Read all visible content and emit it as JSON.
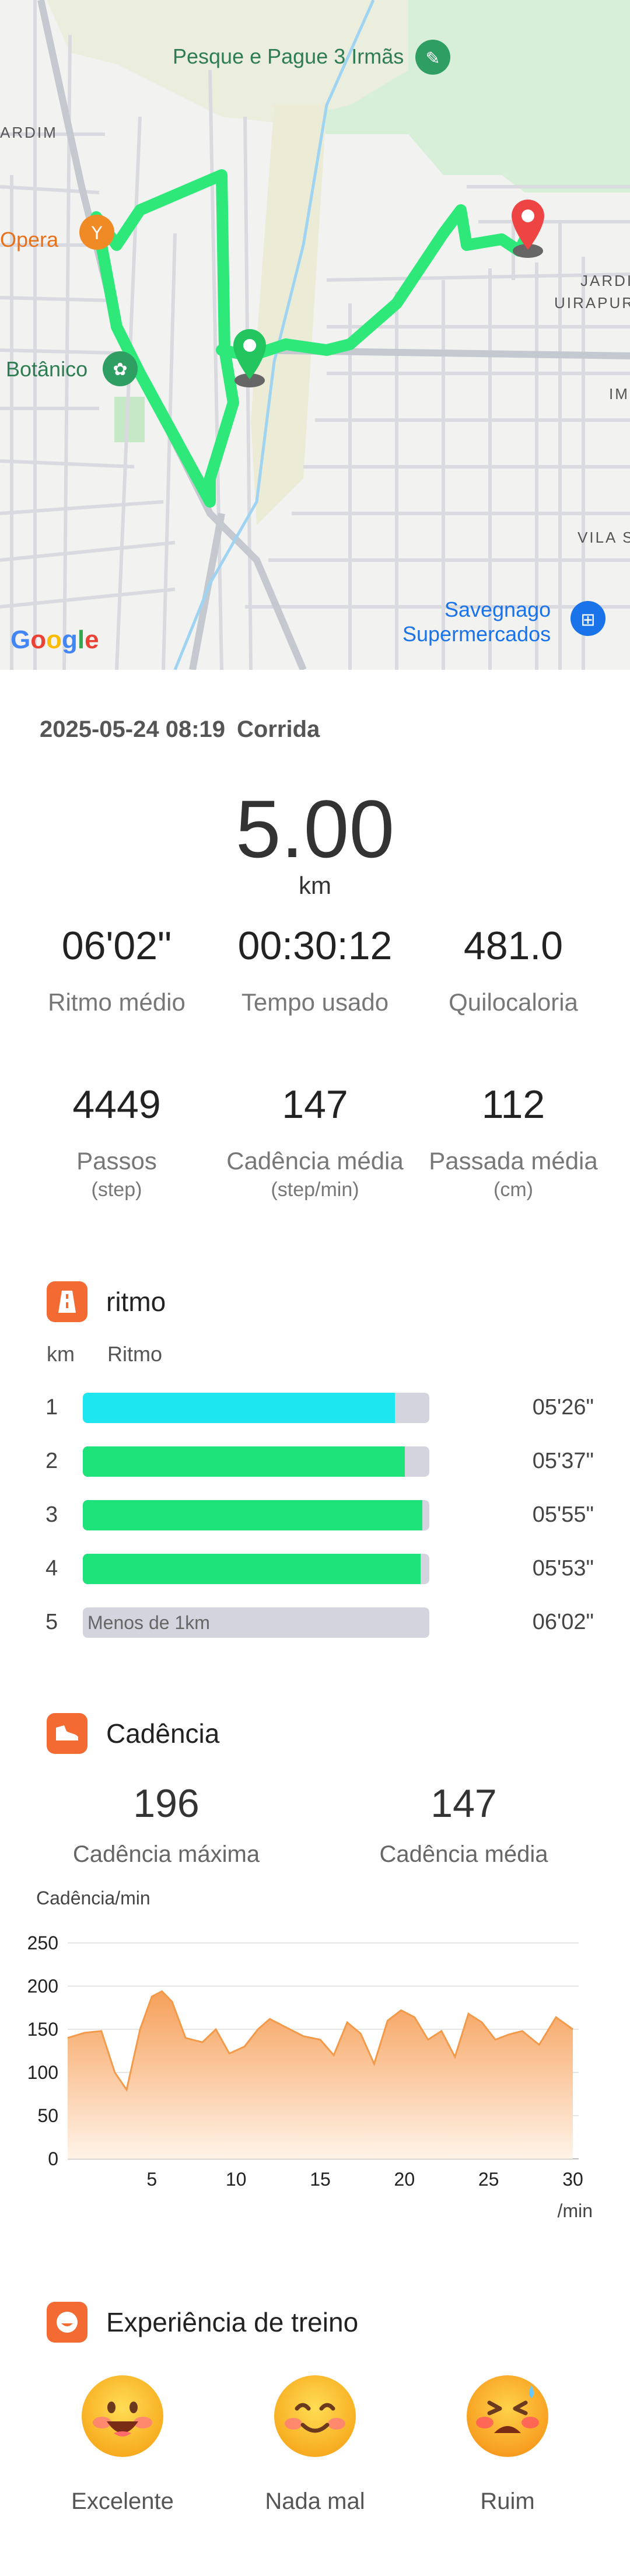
{
  "map": {
    "labels": {
      "pesque": "Pesque e Pague 3 Irmãs",
      "jardim_left": "ARDIM",
      "opera": "Opera",
      "jardim_uirapuru": "JARDIM\nUIRAPURU",
      "botanico": "Botânico",
      "vila": "VILA S",
      "im": "IM",
      "savegnago": "Savegnago\nSupermercados"
    },
    "google_logo": "Google",
    "colors": {
      "route": "#2ee87a",
      "start": "#22c55e",
      "end": "#ef4444"
    }
  },
  "workout": {
    "date": "2025-05-24 08:19",
    "type": "Corrida",
    "distance": "5.00",
    "distance_unit": "km"
  },
  "stats_row1": [
    {
      "value": "06'02\"",
      "label": "Ritmo médio"
    },
    {
      "value": "00:30:12",
      "label": "Tempo usado"
    },
    {
      "value": "481.0",
      "label": "Quilocaloria"
    }
  ],
  "stats_row2": [
    {
      "value": "4449",
      "label": "Passos",
      "unit": "(step)"
    },
    {
      "value": "147",
      "label": "Cadência média",
      "unit": "(step/min)"
    },
    {
      "value": "112",
      "label": "Passada média",
      "unit": "(cm)"
    }
  ],
  "pace": {
    "title": "ritmo",
    "col_km": "km",
    "col_pace": "Ritmo",
    "rows": [
      {
        "km": "1",
        "value": "05'26\"",
        "fill": 0.9,
        "color": "#1ee6f0",
        "note": ""
      },
      {
        "km": "2",
        "value": "05'37\"",
        "fill": 0.93,
        "color": "#1ee27a",
        "note": ""
      },
      {
        "km": "3",
        "value": "05'55\"",
        "fill": 0.98,
        "color": "#1ee27a",
        "note": ""
      },
      {
        "km": "4",
        "value": "05'53\"",
        "fill": 0.975,
        "color": "#1ee27a",
        "note": ""
      },
      {
        "km": "5",
        "value": "06'02\"",
        "fill": 0,
        "color": "#d4d4de",
        "note": "Menos de 1km"
      }
    ]
  },
  "cadence": {
    "title": "Cadência",
    "max_value": "196",
    "max_label": "Cadência máxima",
    "avg_value": "147",
    "avg_label": "Cadência média"
  },
  "chart_data": {
    "type": "area",
    "ylabel": "Cadência/min",
    "xlabel": "/min",
    "ylim": [
      0,
      250
    ],
    "yticks": [
      "250",
      "200",
      "150",
      "100",
      "50",
      "0"
    ],
    "xticks": [
      "5",
      "10",
      "15",
      "20",
      "25",
      "30"
    ],
    "xlim": [
      0,
      30
    ],
    "grid": true,
    "color": "#f6a05a",
    "x": [
      0,
      1,
      2,
      2.8,
      3.5,
      4.3,
      5,
      5.6,
      6.2,
      7,
      8,
      8.8,
      9.6,
      10.5,
      11.3,
      12,
      13,
      14,
      15,
      15.8,
      16.6,
      17.4,
      18.2,
      19,
      19.8,
      20.6,
      21.4,
      22.2,
      23,
      23.8,
      24.6,
      25.4,
      26.2,
      27,
      28,
      29,
      30
    ],
    "y": [
      140,
      146,
      148,
      100,
      80,
      150,
      188,
      194,
      182,
      140,
      135,
      150,
      122,
      130,
      150,
      162,
      152,
      142,
      138,
      120,
      158,
      145,
      110,
      160,
      172,
      164,
      138,
      148,
      118,
      168,
      158,
      138,
      144,
      148,
      132,
      164,
      150
    ]
  },
  "experience": {
    "title": "Experiência de treino",
    "options": [
      {
        "label": "Excelente",
        "icon": "excellent-face-icon"
      },
      {
        "label": "Nada mal",
        "icon": "smile-face-icon"
      },
      {
        "label": "Ruim",
        "icon": "tired-face-icon"
      }
    ]
  }
}
